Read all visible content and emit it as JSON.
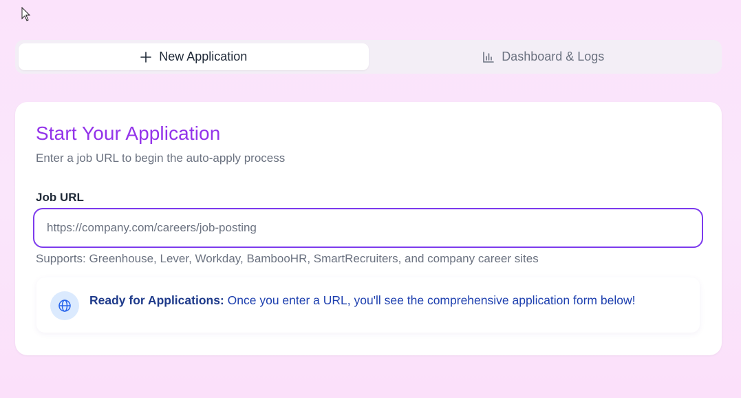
{
  "tabs": [
    {
      "label": "New Application",
      "icon": "plus-icon",
      "active": true
    },
    {
      "label": "Dashboard & Logs",
      "icon": "bar-chart-icon",
      "active": false
    }
  ],
  "card": {
    "title": "Start Your Application",
    "subtitle": "Enter a job URL to begin the auto-apply process",
    "field_label": "Job URL",
    "field_value": "",
    "field_placeholder": "https://company.com/careers/job-posting",
    "hint": "Supports: Greenhouse, Lever, Workday, BambooHR, SmartRecruiters, and company career sites",
    "info": {
      "icon": "globe-icon",
      "bold": "Ready for Applications:",
      "text": "Once you enter a URL, you'll see the comprehensive application form below!"
    }
  },
  "colors": {
    "accent": "#9333ea",
    "input_border": "#7c3aed",
    "info_text": "#1e40af",
    "background": "#fbe3fb"
  }
}
